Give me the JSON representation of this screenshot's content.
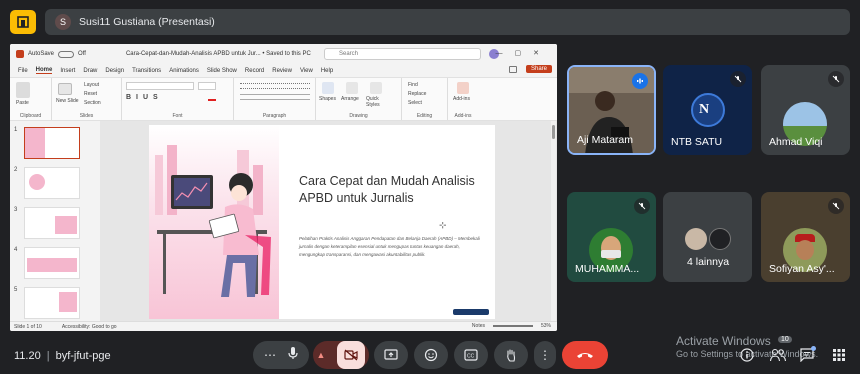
{
  "presenter_bar": {
    "avatar_letter": "S",
    "title": "Susi11 Gustiana (Presentasi)"
  },
  "powerpoint": {
    "autosave": "AutoSave",
    "toggle": "Off",
    "doc_title": "Cara-Cepat-dan-Mudah-Analisis APBD untuk Jur... • Saved to this PC",
    "search_placeholder": "Search",
    "menu": [
      "File",
      "Home",
      "Insert",
      "Draw",
      "Design",
      "Transitions",
      "Animations",
      "Slide Show",
      "Record",
      "Review",
      "View",
      "Help"
    ],
    "share_label": "Share",
    "ribbon_groups": [
      "Clipboard",
      "Slides",
      "Font",
      "Paragraph",
      "Drawing",
      "Editing",
      "Add-ins"
    ],
    "ribbon_items": {
      "paste": "Paste",
      "new_slide": "New Slide",
      "layout": "Layout",
      "reset": "Reset",
      "section": "Section",
      "shapes": "Shapes",
      "arrange": "Arrange",
      "quick_styles": "Quick Styles",
      "find": "Find",
      "replace": "Replace",
      "select": "Select",
      "addins": "Add-ins"
    },
    "thumb_numbers": [
      "1",
      "2",
      "3",
      "4",
      "5"
    ],
    "slide": {
      "title": "Cara Cepat dan Mudah Analisis APBD untuk Jurnalis",
      "subtitle": "Pelatihan Praktis Analisis Anggaran Pendapatan dan Belanja Daerah (APBD) – Membekali jurnalis dengan keterampilan esensial untuk mengupas tuntas keuangan daerah, mengungkap transparansi, dan mengawasi akuntabilitas publik."
    },
    "status": {
      "slide_of": "Slide 1 of 10",
      "accessibility": "Accessibility: Good to go",
      "notes": "Notes",
      "zoom": "53%"
    }
  },
  "participants": [
    {
      "name": "Aji Mataram",
      "state": "speaking"
    },
    {
      "name": "NTB SATU",
      "state": "muted"
    },
    {
      "name": "Ahmad Viqi",
      "state": "muted"
    },
    {
      "name": "MUHAMMA...",
      "state": "muted"
    },
    {
      "name": "4 lainnya",
      "state": "group"
    },
    {
      "name": "Sofiyan Asy'...",
      "state": "muted"
    }
  ],
  "bottom": {
    "time": "11.20",
    "meeting_code": "byf-jfut-pge",
    "activate_title": "Activate Windows",
    "activate_sub": "Go to Settings to activate Windows.",
    "chat_badge": "10"
  },
  "colors": {
    "accent_red": "#ea4335",
    "speaking_blue": "#8ab4f8",
    "ppt_red": "#c43e1c"
  }
}
